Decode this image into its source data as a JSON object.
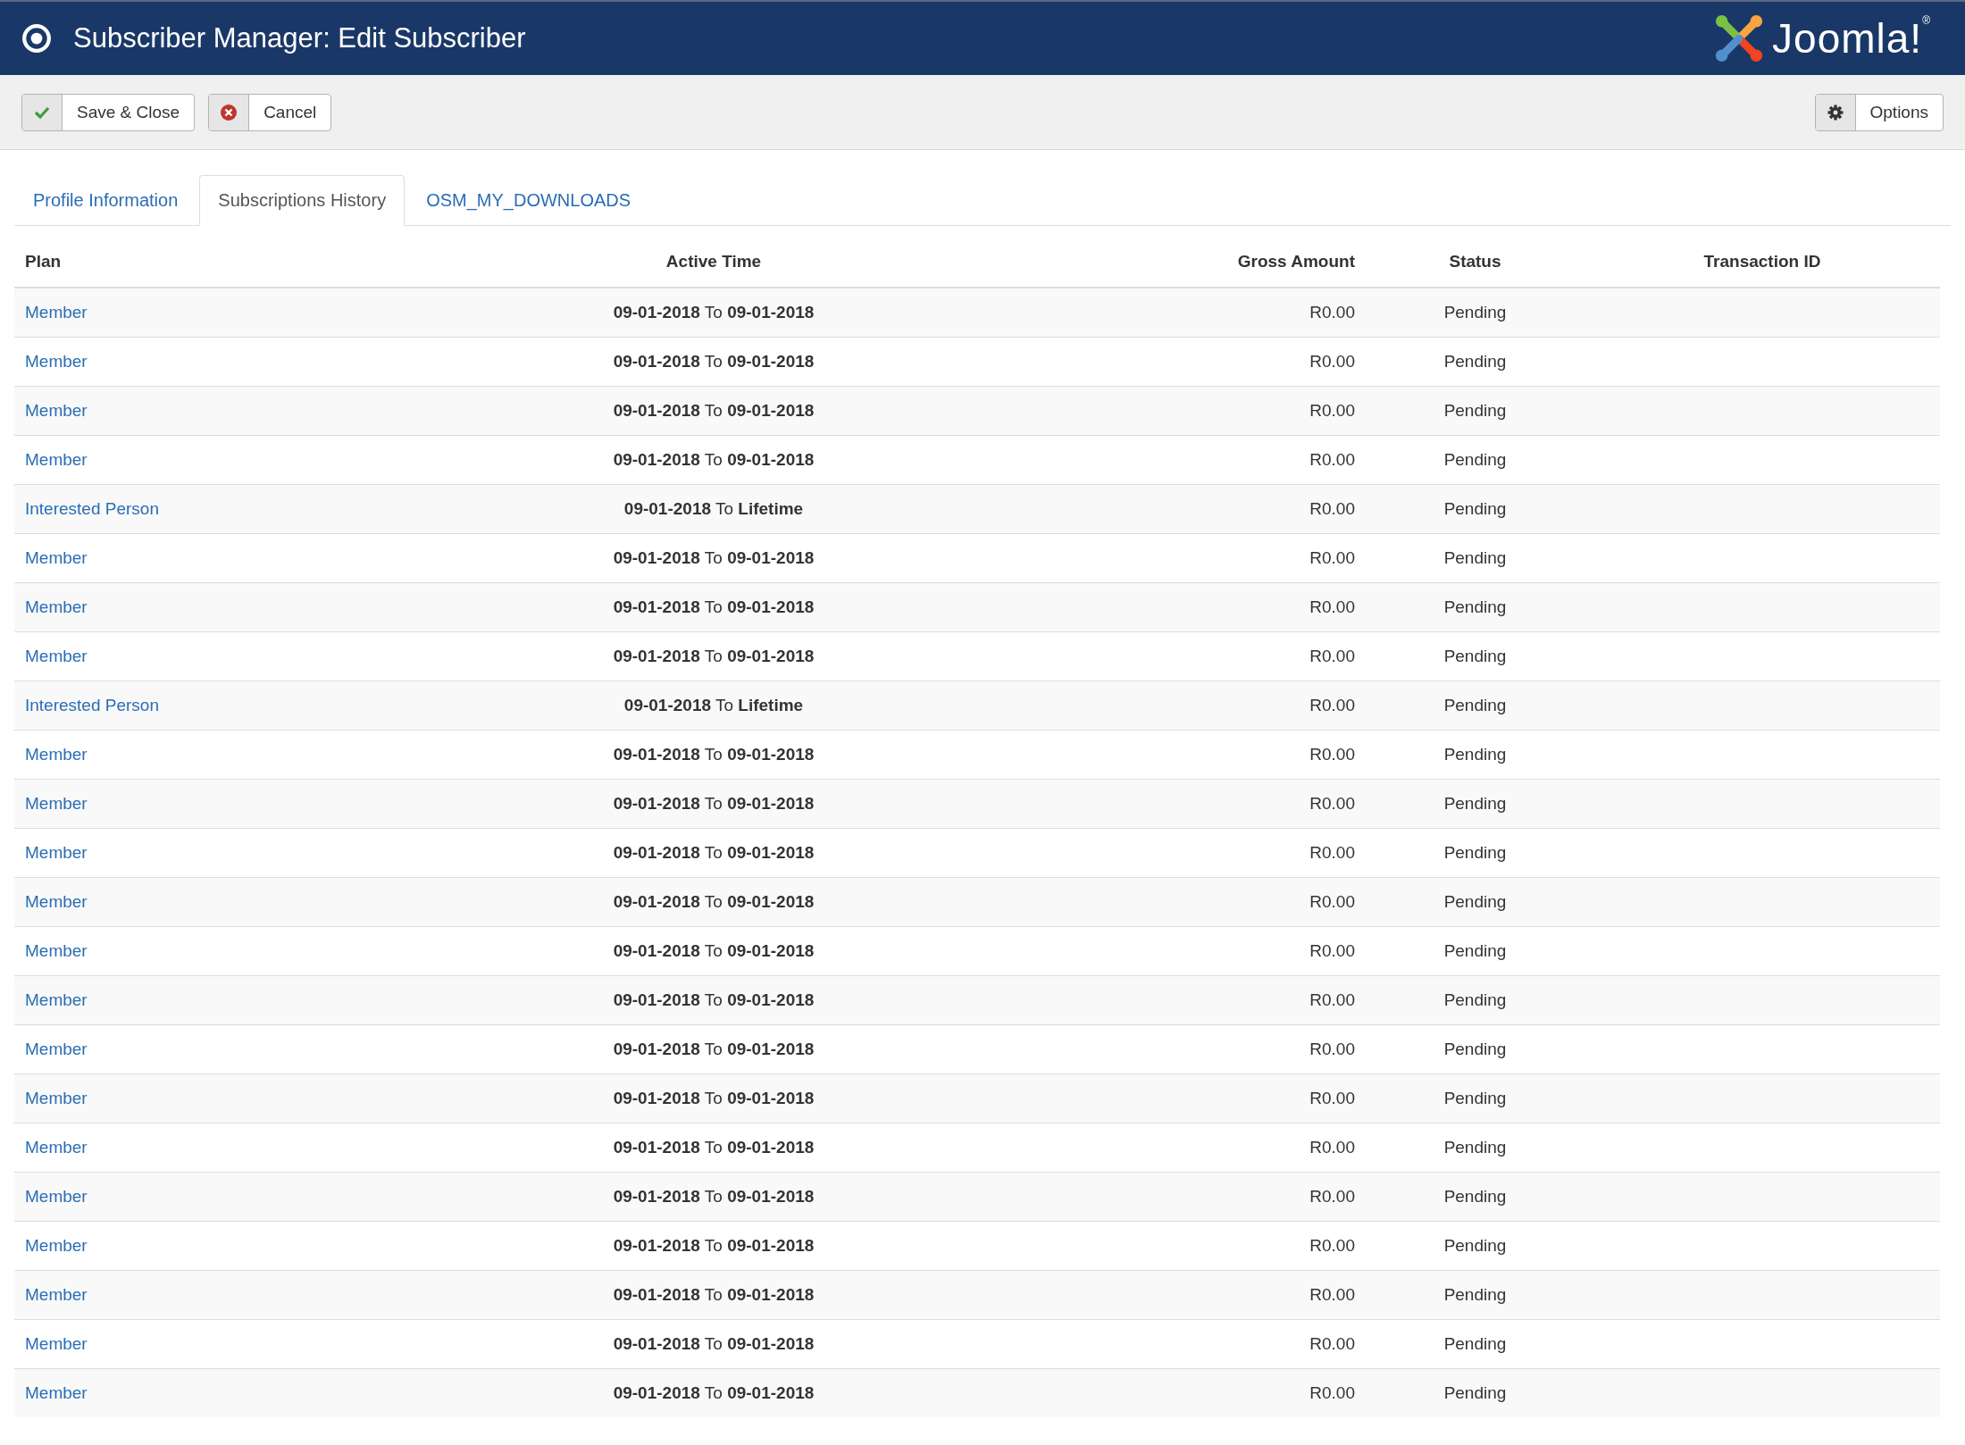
{
  "header": {
    "title": "Subscriber Manager: Edit Subscriber",
    "brand": "Joomla!$^{®}$"
  },
  "toolbar": {
    "buttons": [
      {
        "kind": "save",
        "label": "Save & Close"
      },
      {
        "kind": "cancel",
        "label": "Cancel"
      }
    ],
    "options": {
      "label": "Options"
    }
  },
  "tabs": [
    {
      "label": "Profile Information",
      "selected": false
    },
    {
      "label": "Subscriptions History",
      "selected": true
    },
    {
      "label": "OSM_MY_DOWNLOADS",
      "selected": false
    }
  ],
  "table": {
    "columns": [
      "Plan",
      "Active Time",
      "Gross Amount",
      "Status",
      "Transaction ID"
    ],
    "rows": [
      {
        "plan": "Member",
        "start": "09-01-2018",
        "separator": "To",
        "end": "09-01-2018",
        "amount": "R0.00",
        "status": "Pending"
      },
      {
        "plan": "Member",
        "start": "09-01-2018",
        "separator": "To",
        "end": "09-01-2018",
        "amount": "R0.00",
        "status": "Pending"
      },
      {
        "plan": "Member",
        "start": "09-01-2018",
        "separator": "To",
        "end": "09-01-2018",
        "amount": "R0.00",
        "status": "Pending"
      },
      {
        "plan": "Member",
        "start": "09-01-2018",
        "separator": "To",
        "end": "09-01-2018",
        "amount": "R0.00",
        "status": "Pending"
      },
      {
        "plan": "Interested Person",
        "start": "09-01-2018",
        "separator": "To",
        "end": "Lifetime",
        "amount": "R0.00",
        "status": "Pending"
      },
      {
        "plan": "Member",
        "start": "09-01-2018",
        "separator": "To",
        "end": "09-01-2018",
        "amount": "R0.00",
        "status": "Pending"
      },
      {
        "plan": "Member",
        "start": "09-01-2018",
        "separator": "To",
        "end": "09-01-2018",
        "amount": "R0.00",
        "status": "Pending"
      },
      {
        "plan": "Member",
        "start": "09-01-2018",
        "separator": "To",
        "end": "09-01-2018",
        "amount": "R0.00",
        "status": "Pending"
      },
      {
        "plan": "Interested Person",
        "start": "09-01-2018",
        "separator": "To",
        "end": "Lifetime",
        "amount": "R0.00",
        "status": "Pending"
      },
      {
        "plan": "Member",
        "start": "09-01-2018",
        "separator": "To",
        "end": "09-01-2018",
        "amount": "R0.00",
        "status": "Pending"
      },
      {
        "plan": "Member",
        "start": "09-01-2018",
        "separator": "To",
        "end": "09-01-2018",
        "amount": "R0.00",
        "status": "Pending"
      },
      {
        "plan": "Member",
        "start": "09-01-2018",
        "separator": "To",
        "end": "09-01-2018",
        "amount": "R0.00",
        "status": "Pending"
      },
      {
        "plan": "Member",
        "start": "09-01-2018",
        "separator": "To",
        "end": "09-01-2018",
        "amount": "R0.00",
        "status": "Pending"
      },
      {
        "plan": "Member",
        "start": "09-01-2018",
        "separator": "To",
        "end": "09-01-2018",
        "amount": "R0.00",
        "status": "Pending"
      },
      {
        "plan": "Member",
        "start": "09-01-2018",
        "separator": "To",
        "end": "09-01-2018",
        "amount": "R0.00",
        "status": "Pending"
      },
      {
        "plan": "Member",
        "start": "09-01-2018",
        "separator": "To",
        "end": "09-01-2018",
        "amount": "R0.00",
        "status": "Pending"
      },
      {
        "plan": "Member",
        "start": "09-01-2018",
        "separator": "To",
        "end": "09-01-2018",
        "amount": "R0.00",
        "status": "Pending"
      },
      {
        "plan": "Member",
        "start": "09-01-2018",
        "separator": "To",
        "end": "09-01-2018",
        "amount": "R0.00",
        "status": "Pending"
      },
      {
        "plan": "Member",
        "start": "09-01-2018",
        "separator": "To",
        "end": "09-01-2018",
        "amount": "R0.00",
        "status": "Pending"
      },
      {
        "plan": "Member",
        "start": "09-01-2018",
        "separator": "To",
        "end": "09-01-2018",
        "amount": "R0.00",
        "status": "Pending"
      },
      {
        "plan": "Member",
        "start": "09-01-2018",
        "separator": "To",
        "end": "09-01-2018",
        "amount": "R0.00",
        "status": "Pending"
      },
      {
        "plan": "Member",
        "start": "09-01-2018",
        "separator": "To",
        "end": "09-01-2018",
        "amount": "R0.00",
        "status": "Pending"
      },
      {
        "plan": "Member",
        "start": "09-01-2018",
        "separator": "To",
        "end": "09-01-2018",
        "amount": "R0.00",
        "status": "Pending"
      }
    ]
  }
}
